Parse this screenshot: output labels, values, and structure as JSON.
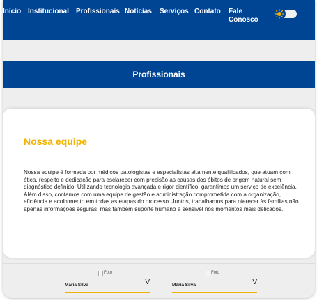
{
  "nav": {
    "items": [
      "Início",
      "Institucional",
      "Profissionais",
      "Notícias",
      "Serviços",
      "Contato",
      "Fale Conosco"
    ]
  },
  "colors": {
    "brand": "#004494",
    "accent": "#f2b300"
  },
  "header": {
    "title": "Profissionais"
  },
  "section": {
    "title": "Nossa equipe",
    "paragraphs": [
      "Nossa equipe é formada por médicos patologistas e especialistas altamente qualificados, que atuam com ética, respeito e dedicação para esclarecer com precisão as causas dos óbitos de origem natural sem diagnóstico definido. Utilizando tecnologia avançada e rigor científico, garantimos um serviço de excelência.",
      "Além disso, contamos com uma equipe de gestão e administração comprometida com a organização, eficiência e acolhimento em todas as etapas do processo. Juntos, trabalhamos para oferecer às famílias não apenas informações seguras, mas também suporte humano e sensível nos momentos mais delicados."
    ]
  },
  "team": {
    "members": [
      {
        "photo_alt": "Foto",
        "name": "Maria Silva",
        "chevron": "V"
      },
      {
        "photo_alt": "Foto",
        "name": "Maria Silva",
        "chevron": "V"
      }
    ]
  }
}
